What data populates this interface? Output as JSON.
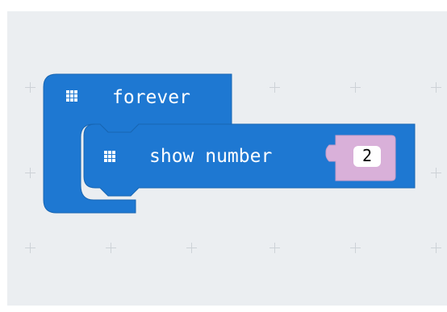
{
  "colors": {
    "workspace_bg": "#ebeef1",
    "basic_block": "#1e78d2",
    "value_block": "#d9b0d9",
    "field_bg": "#ffffff"
  },
  "forever_block": {
    "label": "forever",
    "icon": "led-grid-icon"
  },
  "show_number_block": {
    "label": "show number",
    "icon": "led-grid-icon",
    "value": "2"
  }
}
